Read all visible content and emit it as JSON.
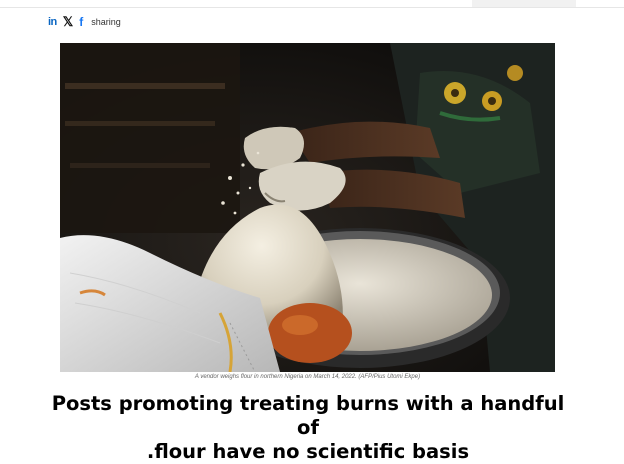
{
  "share": {
    "linkedin_icon": "linkedin-icon",
    "x_icon": "x-icon",
    "facebook_icon": "facebook-icon",
    "label": "sharing"
  },
  "photo": {
    "caption": "A vendor weighs flour in northern Nigeria on March 14, 2022. (AFP/Pius Utomi Ekpe)"
  },
  "article": {
    "headline_line1": "Posts promoting treating burns with a handful of",
    "headline_line2": ".flour have no scientific basis"
  },
  "colors": {
    "linkedin": "#0a66c2",
    "facebook": "#1877f2",
    "headline": "#000000"
  }
}
